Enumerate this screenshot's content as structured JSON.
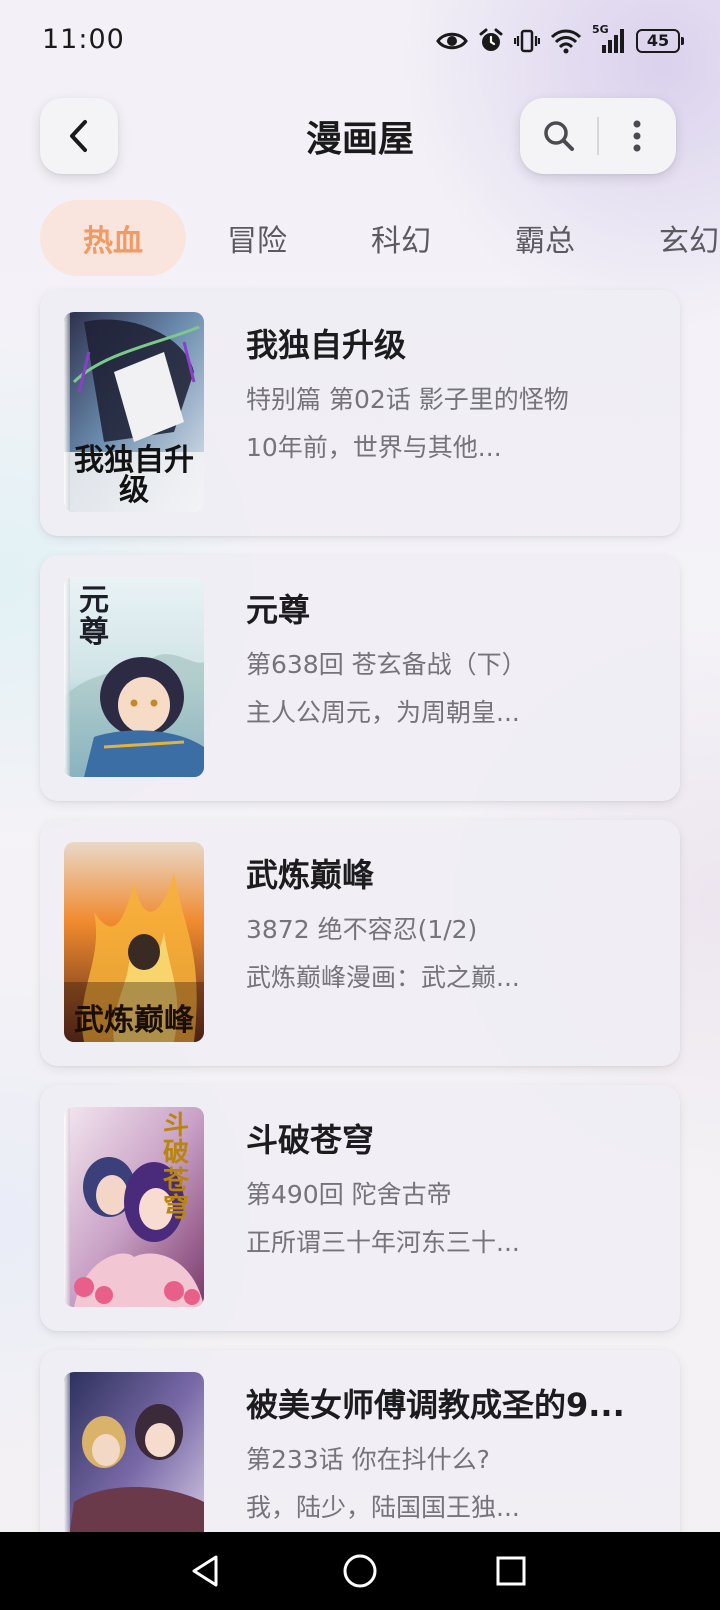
{
  "status_bar": {
    "time": "11:00",
    "network": "5G",
    "battery": "45",
    "icons": [
      "eye-icon",
      "alarm-icon",
      "vibrate-icon",
      "wifi-icon",
      "signal-icon",
      "battery-icon"
    ]
  },
  "header": {
    "title": "漫画屋",
    "back_icon": "chevron-left-icon",
    "search_icon": "search-icon",
    "more_icon": "more-vertical-icon"
  },
  "tabs": [
    {
      "label": "热血",
      "active": true
    },
    {
      "label": "冒险",
      "active": false
    },
    {
      "label": "科幻",
      "active": false
    },
    {
      "label": "霸总",
      "active": false
    },
    {
      "label": "玄幻",
      "active": false
    }
  ],
  "comics": [
    {
      "title": "我独自升级",
      "latest": "特别篇 第02话 影子里的怪物",
      "desc": "10年前，世界与其他...",
      "cover_text": "我独自升级"
    },
    {
      "title": "元尊",
      "latest": "第638回 苍玄备战（下）",
      "desc": "主人公周元，为周朝皇...",
      "cover_text": "元尊"
    },
    {
      "title": "武炼巅峰",
      "latest": "3872 绝不容忍(1/2)",
      "desc": "武炼巅峰漫画：武之巅...",
      "cover_text": "武炼巅峰"
    },
    {
      "title": "斗破苍穹",
      "latest": "第490回 陀舍古帝",
      "desc": "正所谓三十年河东三十...",
      "cover_text": "斗破苍穹"
    },
    {
      "title": "被美女师傅调教成圣的9...",
      "latest": "第233话 你在抖什么?",
      "desc": "我，陆少，陆国国王独..."
    }
  ],
  "colors": {
    "accent": "#f19a62",
    "accent_bg": "#f9e5de",
    "text_primary": "#1c1c1f",
    "text_secondary": "#75747a"
  },
  "nav": {
    "back_icon": "triangle-back-icon",
    "home_icon": "circle-home-icon",
    "recents_icon": "square-recents-icon"
  }
}
